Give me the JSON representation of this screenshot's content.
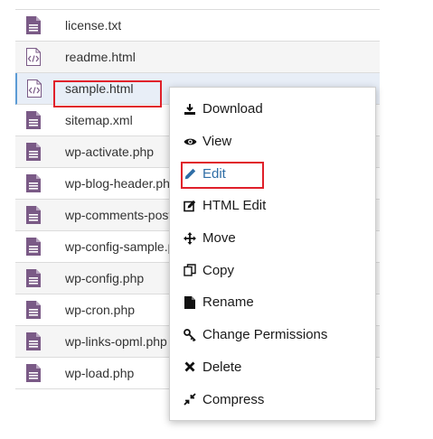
{
  "files": [
    {
      "name": "license.txt",
      "icon": "text-file-icon",
      "type": "txt"
    },
    {
      "name": "readme.html",
      "icon": "code-file-icon",
      "type": "html"
    },
    {
      "name": "sample.html",
      "icon": "code-file-icon",
      "type": "html"
    },
    {
      "name": "sitemap.xml",
      "icon": "text-file-icon",
      "type": "txt"
    },
    {
      "name": "wp-activate.php",
      "icon": "text-file-icon",
      "type": "txt"
    },
    {
      "name": "wp-blog-header.php",
      "icon": "text-file-icon",
      "type": "txt"
    },
    {
      "name": "wp-comments-post.php",
      "icon": "text-file-icon",
      "type": "txt"
    },
    {
      "name": "wp-config-sample.php",
      "icon": "text-file-icon",
      "type": "txt"
    },
    {
      "name": "wp-config.php",
      "icon": "text-file-icon",
      "type": "txt"
    },
    {
      "name": "wp-cron.php",
      "icon": "text-file-icon",
      "type": "txt"
    },
    {
      "name": "wp-links-opml.php",
      "icon": "text-file-icon",
      "type": "txt"
    },
    {
      "name": "wp-load.php",
      "icon": "text-file-icon",
      "type": "txt"
    }
  ],
  "context_menu": {
    "items": [
      {
        "label": "Download",
        "icon": "download-icon"
      },
      {
        "label": "View",
        "icon": "eye-icon"
      },
      {
        "label": "Edit",
        "icon": "pencil-icon"
      },
      {
        "label": "HTML Edit",
        "icon": "edit-square-icon"
      },
      {
        "label": "Move",
        "icon": "move-arrows-icon"
      },
      {
        "label": "Copy",
        "icon": "copy-icon"
      },
      {
        "label": "Rename",
        "icon": "file-icon"
      },
      {
        "label": "Change Permissions",
        "icon": "key-icon"
      },
      {
        "label": "Delete",
        "icon": "x-icon"
      },
      {
        "label": "Compress",
        "icon": "compress-icon"
      }
    ]
  },
  "colors": {
    "file_icon": "#7a5a86",
    "highlight": "#e0202a",
    "selected_row": "#e8eef7",
    "active_menu_text": "#2f6ea6"
  }
}
